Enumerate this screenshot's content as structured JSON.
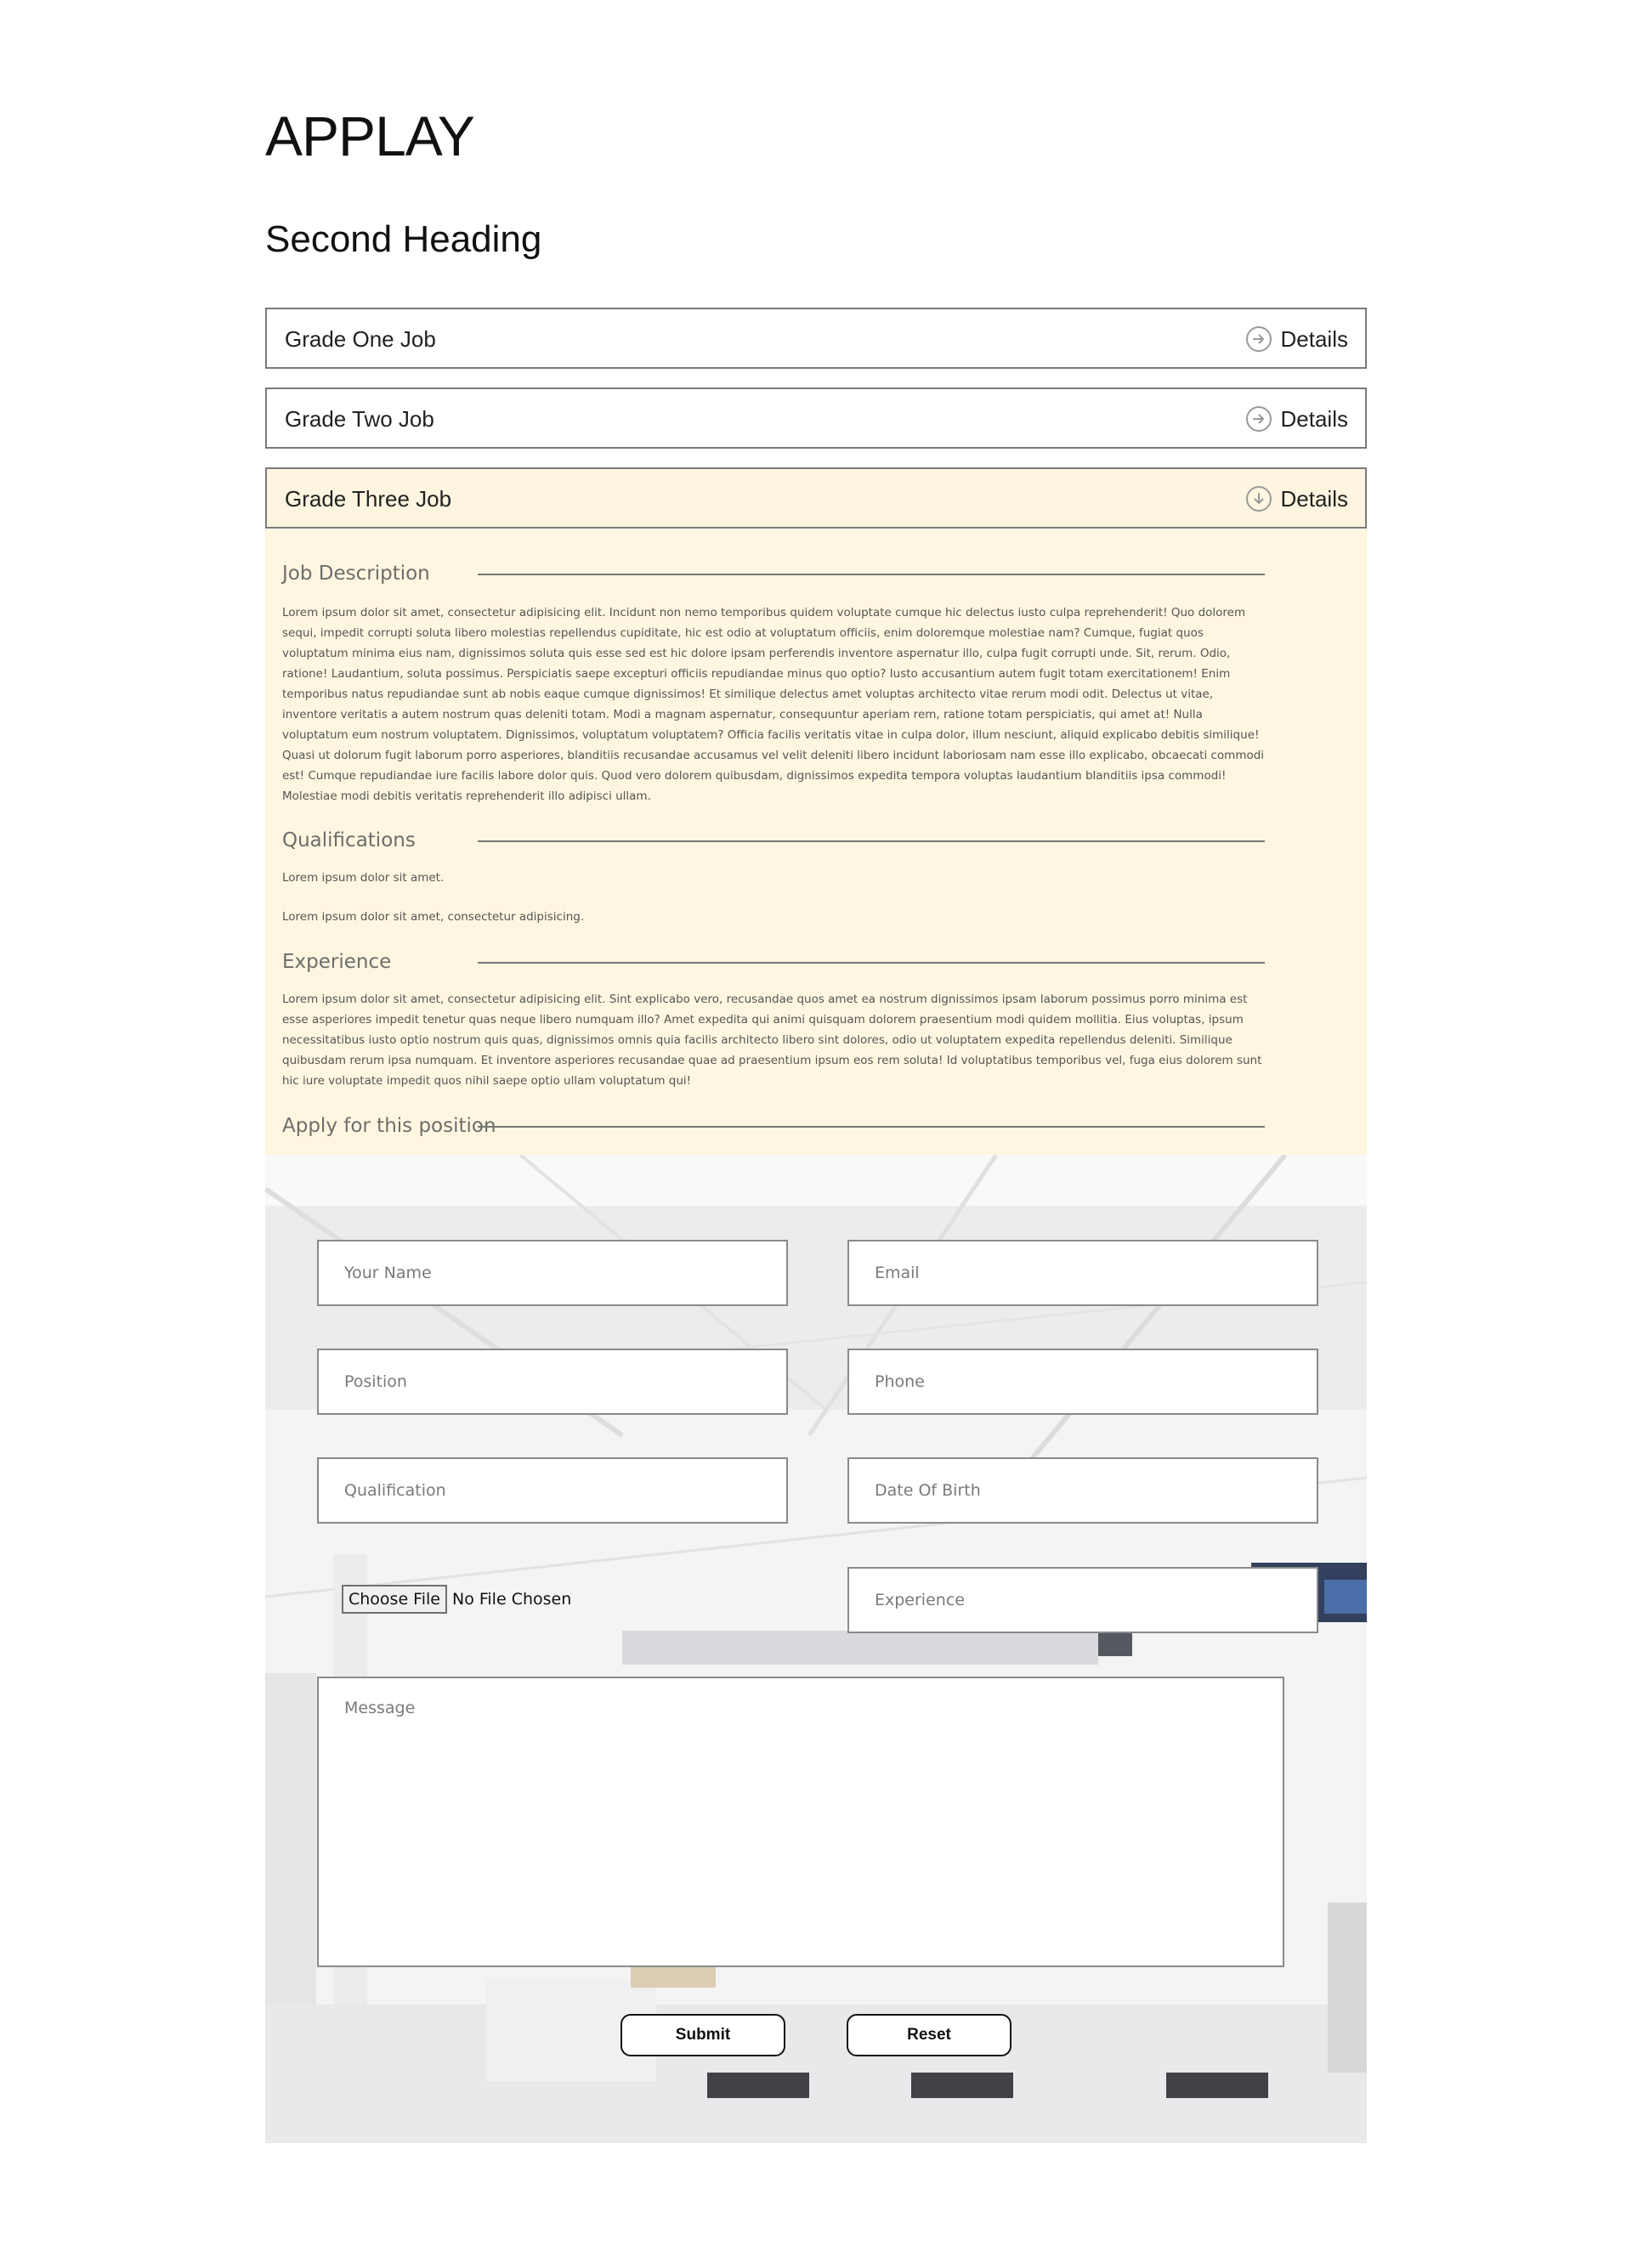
{
  "page": {
    "title": "APPLAY",
    "second_heading": "Second Heading"
  },
  "jobs": [
    {
      "title": "Grade One Job",
      "details_label": "Details",
      "icon": "arrow-right-circle-icon",
      "expanded": false
    },
    {
      "title": "Grade Two Job",
      "details_label": "Details",
      "icon": "arrow-right-circle-icon",
      "expanded": false
    },
    {
      "title": "Grade Three Job",
      "details_label": "Details",
      "icon": "arrow-down-circle-icon",
      "expanded": true
    }
  ],
  "job_detail": {
    "description": {
      "heading": "Job Description",
      "text": "Lorem ipsum dolor sit amet, consectetur adipisicing elit. Incidunt non nemo temporibus quidem voluptate cumque hic delectus iusto culpa reprehenderit! Quo dolorem sequi, impedit corrupti soluta libero molestias repellendus cupiditate, hic est odio at voluptatum officiis, enim doloremque molestiae nam? Cumque, fugiat quos voluptatum minima eius nam, dignissimos soluta quis esse sed est hic dolore ipsam perferendis inventore aspernatur illo, culpa fugit corrupti unde. Sit, rerum. Odio, ratione! Laudantium, soluta possimus. Perspiciatis saepe excepturi officiis repudiandae minus quo optio? Iusto accusantium autem fugit totam exercitationem! Enim temporibus natus repudiandae sunt ab nobis eaque cumque dignissimos! Et similique delectus amet voluptas architecto vitae rerum modi odit. Delectus ut vitae, inventore veritatis a autem nostrum quas deleniti totam. Modi a magnam aspernatur, consequuntur aperiam rem, ratione totam perspiciatis, qui amet at! Nulla voluptatum eum nostrum voluptatem. Dignissimos, voluptatum voluptatem? Officia facilis veritatis vitae in culpa dolor, illum nesciunt, aliquid explicabo debitis similique! Quasi ut dolorum fugit laborum porro asperiores, blanditiis recusandae accusamus vel velit deleniti libero incidunt laboriosam nam esse illo explicabo, obcaecati commodi est! Cumque repudiandae iure facilis labore dolor quis. Quod vero dolorem quibusdam, dignissimos expedita tempora voluptas laudantium blanditiis ipsa commodi! Molestiae modi debitis veritatis reprehenderit illo adipisci ullam."
    },
    "qualifications": {
      "heading": "Qualifications",
      "items": [
        "Lorem ipsum dolor sit amet.",
        "Lorem ipsum dolor sit amet, consectetur adipisicing."
      ]
    },
    "experience": {
      "heading": "Experience",
      "text": "Lorem ipsum dolor sit amet, consectetur adipisicing elit. Sint explicabo vero, recusandae quos amet ea nostrum dignissimos ipsam laborum possimus porro minima est esse asperiores impedit tenetur quas neque libero numquam illo? Amet expedita qui animi quisquam dolorem praesentium modi quidem mollitia. Eius voluptas, ipsum necessitatibus iusto optio nostrum quis quas, dignissimos omnis quia facilis architecto libero sint dolores, odio ut voluptatem expedita repellendus deleniti. Similique quibusdam rerum ipsa numquam. Et inventore asperiores recusandae quae ad praesentium ipsum eos rem soluta! Id voluptatibus temporibus vel, fuga eius dolorem sunt hic iure voluptate impedit quos nihil saepe optio ullam voluptatum qui!"
    },
    "apply_heading": "Apply for this position"
  },
  "form": {
    "name_placeholder": "Your Name",
    "email_placeholder": "Email",
    "position_placeholder": "Position",
    "phone_placeholder": "Phone",
    "qualification_placeholder": "Qualification",
    "dob_placeholder": "Date Of Birth",
    "file_button": "Choose File",
    "file_status": "No File Chosen",
    "experience_placeholder": "Experience",
    "message_placeholder": "Message",
    "submit_label": "Submit",
    "reset_label": "Reset"
  },
  "colors": {
    "expanded_panel_bg": "#fef6e0",
    "border": "#7a7a7a"
  }
}
